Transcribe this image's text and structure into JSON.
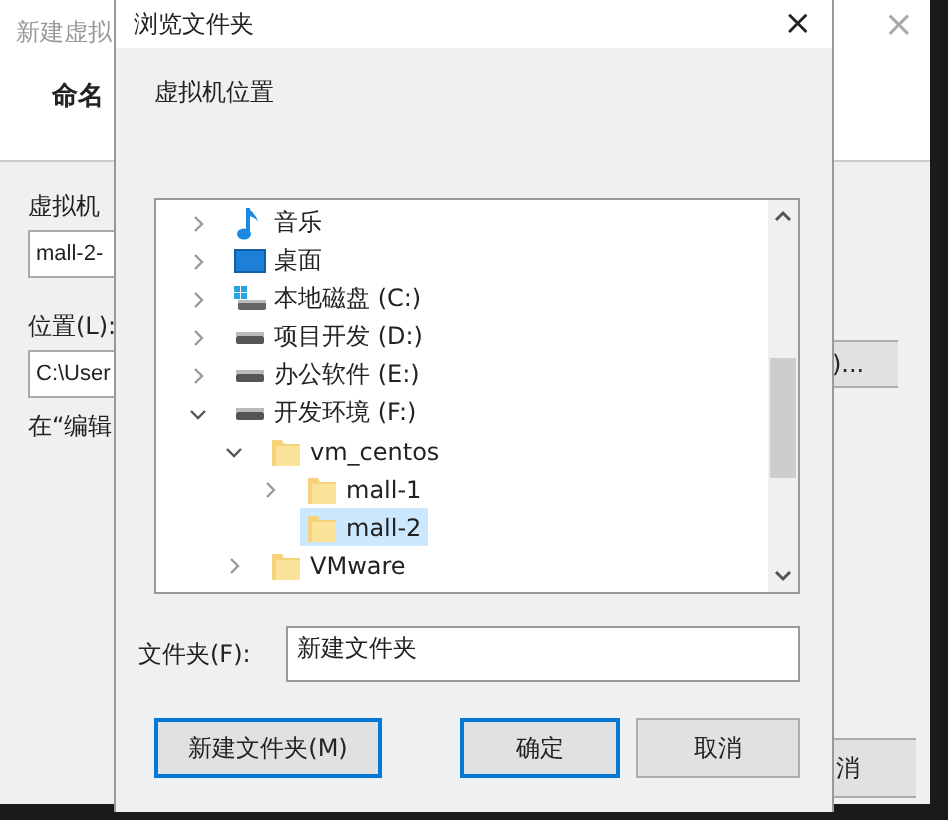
{
  "background_window": {
    "title": "新建虚拟",
    "heading": "命名",
    "name_label": "虚拟机",
    "name_value": "mall-2-",
    "location_label": "位置(L):",
    "location_value": "C:\\User",
    "note": "在“编辑",
    "close": "×",
    "browse_button": ")...",
    "bottom_button": "消"
  },
  "dialog": {
    "title": "浏览文件夹",
    "close": "×",
    "description": "虚拟机位置",
    "tree": [
      {
        "label": "音乐",
        "kind": "music",
        "expanded": false,
        "selected": false
      },
      {
        "label": "桌面",
        "kind": "desktop",
        "expanded": false,
        "selected": false
      },
      {
        "label": "本地磁盘 (C:)",
        "kind": "system-drive",
        "expanded": false,
        "selected": false
      },
      {
        "label": "项目开发 (D:)",
        "kind": "drive",
        "expanded": false,
        "selected": false
      },
      {
        "label": "办公软件 (E:)",
        "kind": "drive",
        "expanded": false,
        "selected": false
      },
      {
        "label": "开发环境 (F:)",
        "kind": "drive",
        "expanded": true,
        "selected": false,
        "children": [
          {
            "label": "vm_centos",
            "kind": "folder",
            "expanded": true,
            "selected": false,
            "children": [
              {
                "label": "mall-1",
                "kind": "folder",
                "expanded": false,
                "selected": false
              },
              {
                "label": "mall-2",
                "kind": "folder",
                "selected": true
              }
            ]
          },
          {
            "label": "VMware",
            "kind": "folder",
            "expanded": false,
            "selected": false
          }
        ]
      }
    ],
    "folder_label": "文件夹(F):",
    "folder_value": "新建文件夹",
    "buttons": [
      {
        "label": "新建文件夹(M)",
        "default": false,
        "focused": true
      },
      {
        "label": "确定",
        "default": true,
        "focused": false
      },
      {
        "label": "取消",
        "default": false,
        "focused": false
      }
    ]
  }
}
